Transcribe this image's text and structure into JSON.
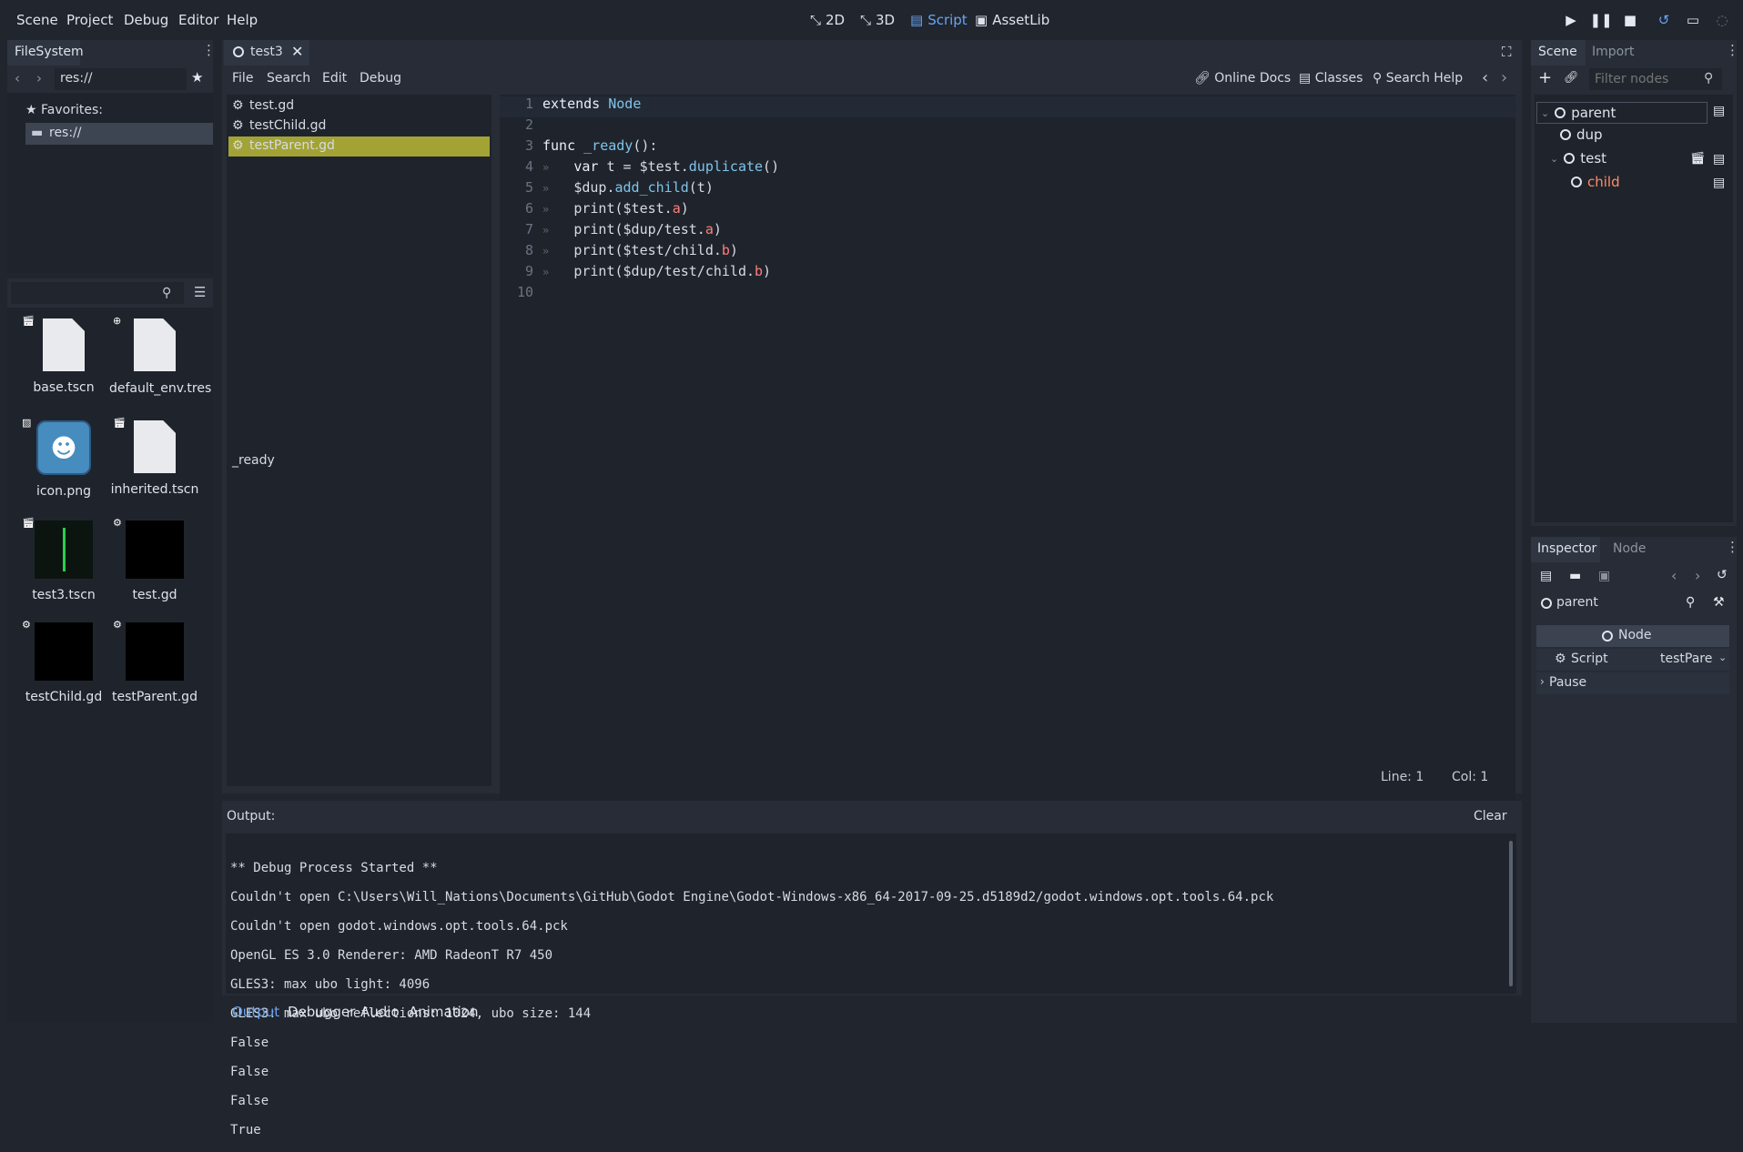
{
  "menu": [
    "Scene",
    "Project",
    "Debug",
    "Editor",
    "Help"
  ],
  "workspaces": [
    "2D",
    "3D",
    "Script",
    "AssetLib"
  ],
  "active_workspace": "Script",
  "filesystem": {
    "tab": "FileSystem",
    "path": "res://",
    "favorites_label": "Favorites:",
    "root_item": "res://",
    "files": [
      {
        "name": "base.tscn",
        "kind": "scene"
      },
      {
        "name": "default_env.tres",
        "kind": "resource"
      },
      {
        "name": "icon.png",
        "kind": "image"
      },
      {
        "name": "inherited.tscn",
        "kind": "scene"
      },
      {
        "name": "test3.tscn",
        "kind": "scene-thumb"
      },
      {
        "name": "test.gd",
        "kind": "script"
      },
      {
        "name": "testChild.gd",
        "kind": "script"
      },
      {
        "name": "testParent.gd",
        "kind": "script"
      }
    ]
  },
  "script_editor": {
    "open_tab": "test3",
    "menu": [
      "File",
      "Search",
      "Edit",
      "Debug"
    ],
    "help_buttons": [
      "Online Docs",
      "Classes",
      "Search Help"
    ],
    "scripts": [
      "test.gd",
      "testChild.gd",
      "testParent.gd"
    ],
    "selected_script": "testParent.gd",
    "methods": [
      "_ready"
    ],
    "line_numbers": [
      "1",
      "2",
      "3",
      "4",
      "5",
      "6",
      "7",
      "8",
      "9",
      "10"
    ],
    "status": {
      "line": "Line: 1",
      "col": "Col: 1"
    }
  },
  "output": {
    "label": "Output:",
    "clear_label": "Clear",
    "lines": [
      "** Debug Process Started **",
      "Couldn't open C:\\Users\\Will_Nations\\Documents\\GitHub\\Godot Engine\\Godot-Windows-x86_64-2017-09-25.d5189d2/godot.windows.opt.tools.64.pck",
      "Couldn't open godot.windows.opt.tools.64.pck",
      "OpenGL ES 3.0 Renderer: AMD RadeonT R7 450",
      "GLES3: max ubo light: 4096",
      "GLES3: max ubo reflections: 1024, ubo size: 144",
      "False",
      "False",
      "False",
      "True"
    ]
  },
  "bottom_tabs": [
    "Output",
    "Debugger",
    "Audio",
    "Animation"
  ],
  "scene_panel": {
    "tabs": [
      "Scene",
      "Import"
    ],
    "filter_placeholder": "Filter nodes",
    "nodes": [
      "parent",
      "dup",
      "test",
      "child"
    ]
  },
  "inspector": {
    "tabs": [
      "Inspector",
      "Node"
    ],
    "object": "parent",
    "section": "Node",
    "script_label": "Script",
    "script_value": "testPare",
    "pause_label": "Pause"
  },
  "colors": {
    "accent": "#6aa4f0",
    "selected_script": "#a3a335",
    "child_node": "#ff8c6a"
  }
}
